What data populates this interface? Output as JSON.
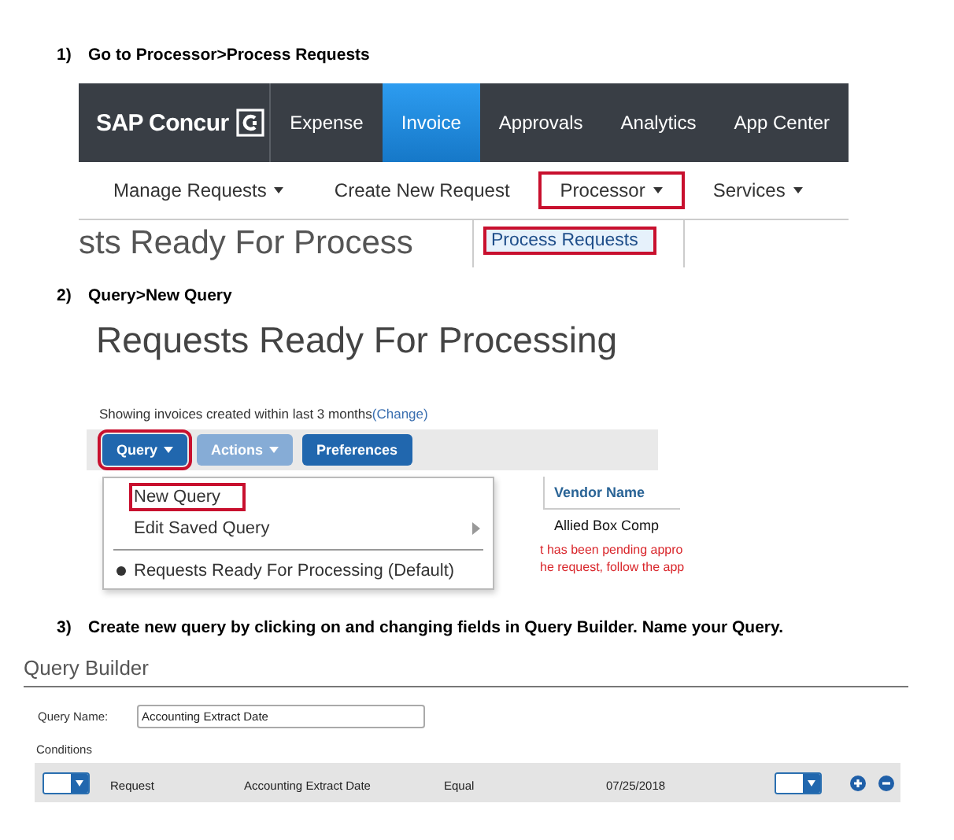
{
  "step_1": {
    "number": "1)",
    "instruction": "Go to Processor>Process Requests"
  },
  "concur_screen": {
    "brand": "SAP Concur",
    "tabs": [
      {
        "label": "Expense",
        "selected": false
      },
      {
        "label": "Invoice",
        "selected": true
      },
      {
        "label": "Approvals",
        "selected": false
      },
      {
        "label": "Analytics",
        "selected": false
      },
      {
        "label": "App Center",
        "selected": false
      }
    ],
    "subnav": [
      {
        "label": "Manage Requests",
        "caret": true,
        "highlighted": false
      },
      {
        "label": "Create New Request",
        "caret": false,
        "highlighted": false
      },
      {
        "label": "Processor",
        "caret": true,
        "highlighted": true
      },
      {
        "label": "Services",
        "caret": true,
        "highlighted": false
      }
    ],
    "page_heading": "sts Ready For Process",
    "dropdown": [
      {
        "label": "Process Requests",
        "selected": true,
        "highlighted": true
      }
    ]
  },
  "step_2": {
    "number": "2)",
    "instruction": "Query>New Query"
  },
  "requests_screen": {
    "title": "Requests Ready For Processing",
    "filter_text": "Showing invoices created within last 3 months",
    "filter_link": "(Change)",
    "toolbar": [
      {
        "label": "Query",
        "caret": true,
        "disabled": false,
        "highlighted": true
      },
      {
        "label": "Actions",
        "caret": true,
        "disabled": true,
        "highlighted": false
      },
      {
        "label": "Preferences",
        "caret": false,
        "disabled": false,
        "highlighted": false
      }
    ],
    "column_header": "Vendor Name",
    "vendor_cell": "Allied Box Comp",
    "message_lines": [
      "t has been pending appro",
      "he request, follow the app"
    ],
    "menu": [
      {
        "kind": "item",
        "label": "New Query",
        "highlighted": true
      },
      {
        "kind": "submenu",
        "label": "Edit Saved Query",
        "highlighted": false
      },
      {
        "kind": "divider"
      },
      {
        "kind": "radio",
        "label": "Requests Ready For Processing (Default)",
        "checked": true,
        "highlighted": false
      }
    ]
  },
  "step_3": {
    "number": "3)",
    "instruction": "Create new query by clicking on and changing fields in Query Builder. Name your Query."
  },
  "query_builder": {
    "title": "Query Builder",
    "name_label": "Query Name:",
    "name_value": "Accounting Extract Date",
    "conditions_label": "Conditions",
    "condition": [
      "Request",
      "Accounting Extract Date",
      "Equal",
      "07/25/2018"
    ]
  }
}
